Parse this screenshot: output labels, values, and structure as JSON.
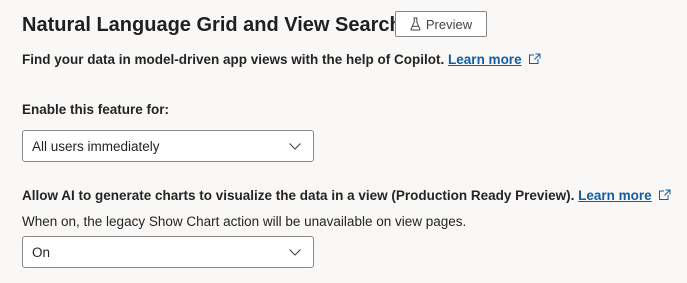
{
  "header": {
    "title": "Natural Language Grid and View Search",
    "badge_label": "Preview",
    "badge_icon": "flask-icon"
  },
  "description": {
    "text": "Find your data in model-driven app views with the help of Copilot.",
    "link_label": "Learn more",
    "link_icon": "external-link-icon"
  },
  "enable_section": {
    "label": "Enable this feature for:",
    "selected_value": "All users immediately"
  },
  "charts_section": {
    "label": "Allow AI to generate charts to visualize the data in a view (Production Ready Preview).",
    "link_label": "Learn more",
    "link_icon": "external-link-icon",
    "note": "When on, the legacy Show Chart action will be unavailable on view pages.",
    "selected_value": "On"
  },
  "colors": {
    "background": "#f9f8f7",
    "link": "#115ea3",
    "border": "#8a8886"
  }
}
